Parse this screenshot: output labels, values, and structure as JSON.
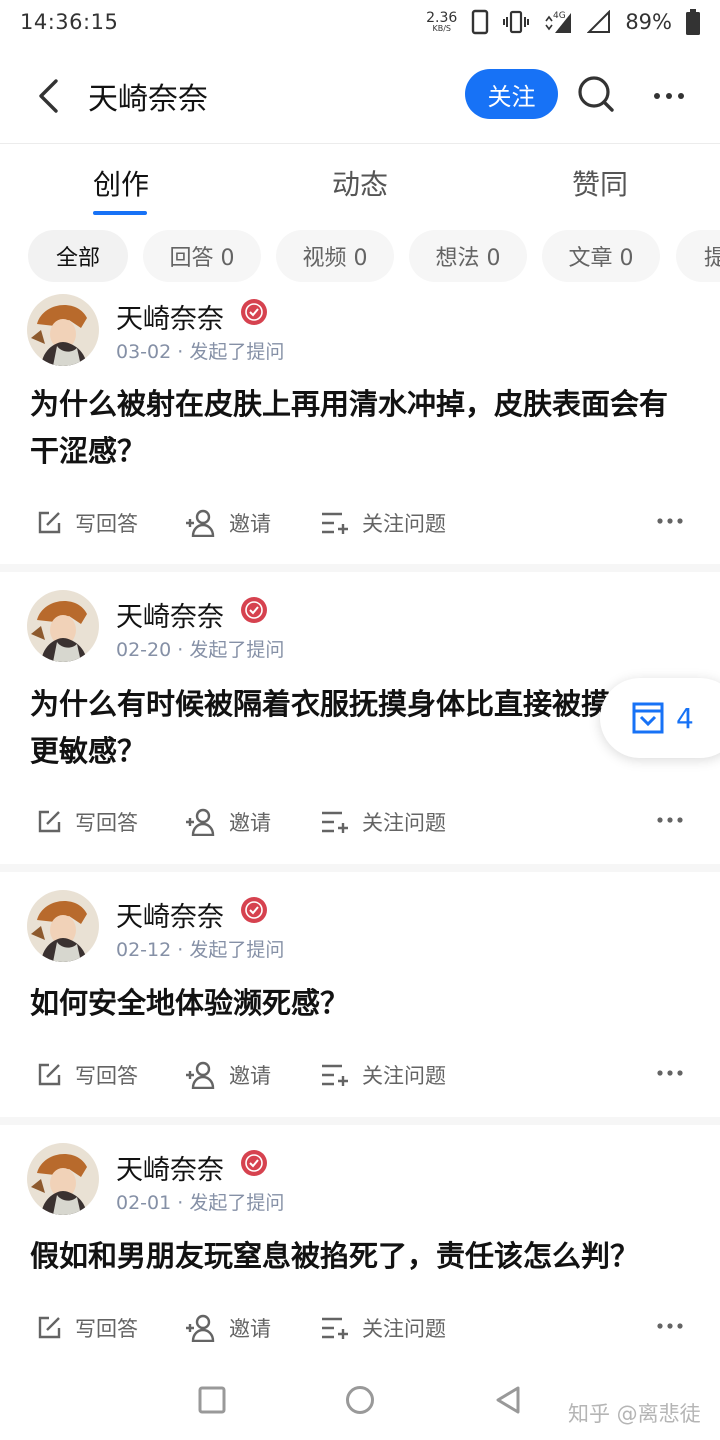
{
  "status_bar": {
    "time": "14:36:15",
    "net_speed_value": "2.36",
    "net_speed_unit": "KB/S",
    "network_type": "4G",
    "battery": "89%"
  },
  "header": {
    "title": "天崎奈奈",
    "follow_label": "关注"
  },
  "tabs": [
    {
      "label": "创作"
    },
    {
      "label": "动态"
    },
    {
      "label": "赞同"
    }
  ],
  "filters": [
    {
      "label": "全部"
    },
    {
      "label": "回答 0"
    },
    {
      "label": "视频 0"
    },
    {
      "label": "想法 0"
    },
    {
      "label": "文章 0"
    },
    {
      "label": "提"
    }
  ],
  "cards": [
    {
      "author": "天崎奈奈",
      "meta": "03-02 · 发起了提问",
      "title": "为什么被射在皮肤上再用清水冲掉，皮肤表面会有干涩感？",
      "actions": {
        "answer": "写回答",
        "invite": "邀请",
        "follow": "关注问题"
      }
    },
    {
      "author": "天崎奈奈",
      "meta": "02-20 · 发起了提问",
      "title": "为什么有时候被隔着衣服抚摸身体比直接被摸更敏感？",
      "actions": {
        "answer": "写回答",
        "invite": "邀请",
        "follow": "关注问题"
      }
    },
    {
      "author": "天崎奈奈",
      "meta": "02-12 · 发起了提问",
      "title": "如何安全地体验濒死感？",
      "actions": {
        "answer": "写回答",
        "invite": "邀请",
        "follow": "关注问题"
      }
    },
    {
      "author": "天崎奈奈",
      "meta": "02-01 · 发起了提问",
      "title": "假如和男朋友玩窒息被掐死了，责任该怎么判？",
      "actions": {
        "answer": "写回答",
        "invite": "邀请",
        "follow": "关注问题"
      }
    }
  ],
  "floating_badge": {
    "count": "4"
  },
  "watermark": "知乎 @离悲徒",
  "colors": {
    "accent": "#1772f6",
    "meta": "#8590a6",
    "verified": "#d6424f"
  }
}
